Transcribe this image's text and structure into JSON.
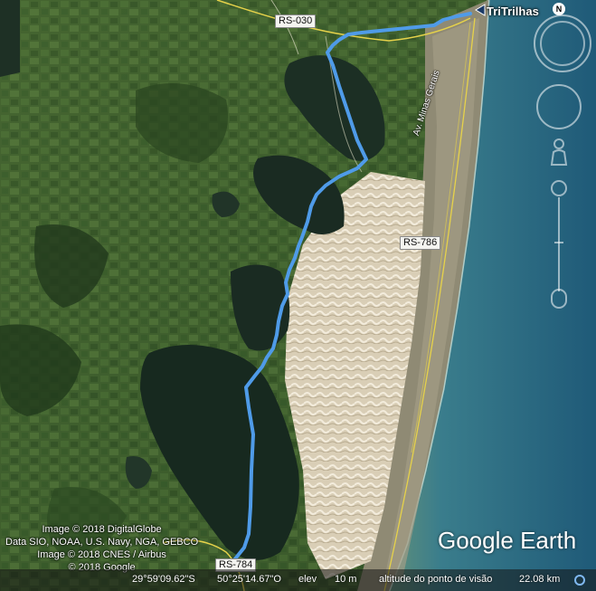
{
  "placemark": {
    "name": "TriTrilhas"
  },
  "north_indicator": "N",
  "roads": {
    "rs030": "RS-030",
    "rs786": "RS-786",
    "rs784": "RS-784",
    "avenue": "Av. Minas Gerais"
  },
  "credits": [
    "Image © 2018 DigitalGlobe",
    "Data SIO, NOAA, U.S. Navy, NGA, GEBCO",
    "Image © 2018 CNES / Airbus",
    "© 2018 Google"
  ],
  "brand": "Google Earth",
  "status": {
    "latitude": "29°59'09.62\"S",
    "longitude": "50°25'14.67\"O",
    "elev_label": "elev",
    "elev_value": "10 m",
    "eye_alt_label": "altitude do ponto de visão",
    "eye_alt_value": "22.08 km"
  },
  "colors": {
    "track": "#4f9be8",
    "ocean": "#2d6f86",
    "dunes": "#e7ddc8",
    "vegetation": "#3d5a2a",
    "lagoon": "#1f3326",
    "road": "#e6d24a"
  },
  "icons": {
    "placemark": "placemark-flag-icon",
    "compass": "compass-ring-icon",
    "look": "look-joystick-icon",
    "move": "move-joystick-icon",
    "zoom": "zoom-slider-icon",
    "pegman": "street-view-pegman-icon",
    "loading": "loading-circle-icon"
  }
}
